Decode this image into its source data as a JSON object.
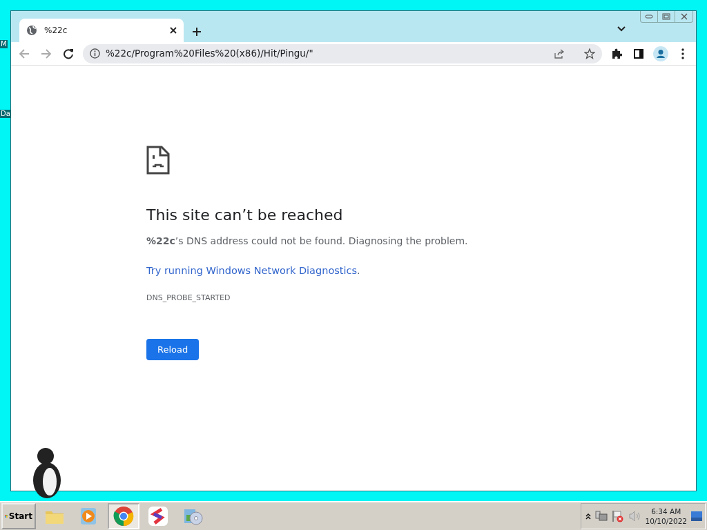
{
  "desktop": {
    "icon_labels": [
      "M",
      "Da"
    ]
  },
  "browser": {
    "tabs": [
      {
        "title": "%22c",
        "selected": true
      }
    ],
    "address": "%22c/Program%20Files%20(x86)/Hit/Pingu/\"",
    "page": {
      "title": "This site can’t be reached",
      "message": "**%22c**’s DNS address could not be found. Diagnosing the problem.",
      "link": "Try running Windows Network Diagnostics",
      "link_suffix": ".",
      "error_code": "DNS_PROBE_STARTED",
      "button": "Reload"
    }
  },
  "taskbar": {
    "start": "Start",
    "apps": [
      {
        "kind": "folder",
        "selected": false
      },
      {
        "kind": "media",
        "selected": false
      },
      {
        "kind": "chrome",
        "selected": true
      },
      {
        "kind": "slides",
        "selected": false
      },
      {
        "kind": "setup",
        "selected": false
      }
    ],
    "time": "6:34 AM",
    "date": "10/10/2022"
  }
}
